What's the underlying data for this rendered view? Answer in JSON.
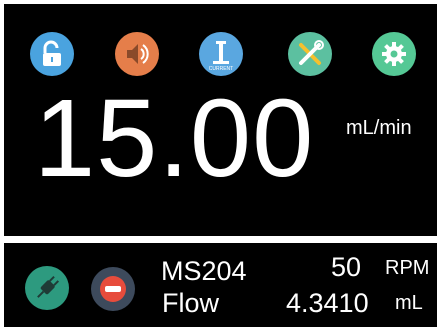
{
  "toolbar": {
    "icons": [
      "unlock-icon",
      "sound-icon",
      "current-icon",
      "tools-icon",
      "settings-icon"
    ],
    "current_icon_text": "CURRENT"
  },
  "display": {
    "flow_value": "15.00",
    "flow_unit": "mL/min"
  },
  "status": {
    "model": "MS204",
    "mode": "Flow",
    "speed_value": "50",
    "speed_unit": "RPM",
    "volume_value": "4.3410",
    "volume_unit": "mL"
  },
  "colors": {
    "unlock": "#4aa3df",
    "sound": "#e57e4a",
    "current": "#5aa7e0",
    "tools": "#5cc0a0",
    "settings": "#55c895",
    "power": "#2d9a7f",
    "stop": "#3d4a5c",
    "stop_bar": "#e74c3c"
  }
}
